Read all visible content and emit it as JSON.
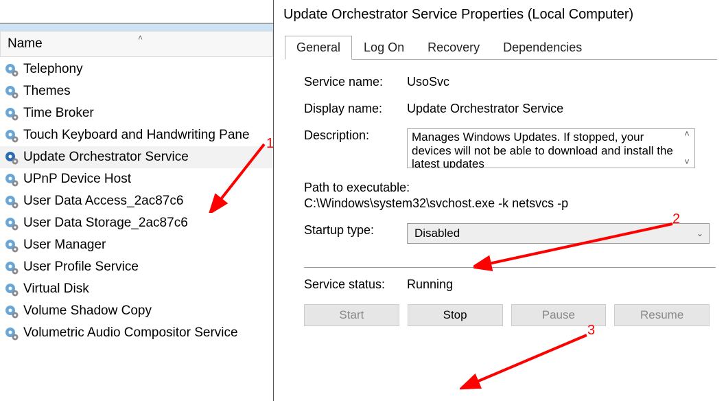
{
  "list": {
    "header": "Name",
    "items": [
      {
        "label": "Telephony",
        "selected": false
      },
      {
        "label": "Themes",
        "selected": false
      },
      {
        "label": "Time Broker",
        "selected": false
      },
      {
        "label": "Touch Keyboard and Handwriting Pane",
        "selected": false
      },
      {
        "label": "Update Orchestrator Service",
        "selected": true
      },
      {
        "label": "UPnP Device Host",
        "selected": false
      },
      {
        "label": "User Data Access_2ac87c6",
        "selected": false
      },
      {
        "label": "User Data Storage_2ac87c6",
        "selected": false
      },
      {
        "label": "User Manager",
        "selected": false
      },
      {
        "label": "User Profile Service",
        "selected": false
      },
      {
        "label": "Virtual Disk",
        "selected": false
      },
      {
        "label": "Volume Shadow Copy",
        "selected": false
      },
      {
        "label": "Volumetric Audio Compositor Service",
        "selected": false
      }
    ]
  },
  "dialog": {
    "title": "Update Orchestrator Service Properties (Local Computer)",
    "tabs": [
      "General",
      "Log On",
      "Recovery",
      "Dependencies"
    ],
    "active_tab": 0,
    "service_name_label": "Service name:",
    "service_name": "UsoSvc",
    "display_name_label": "Display name:",
    "display_name": "Update Orchestrator Service",
    "description_label": "Description:",
    "description": "Manages Windows Updates. If stopped, your devices will not be able to download and install the latest updates",
    "path_label": "Path to executable:",
    "path": "C:\\Windows\\system32\\svchost.exe -k netsvcs -p",
    "startup_label": "Startup type:",
    "startup_value": "Disabled",
    "status_label": "Service status:",
    "status_value": "Running",
    "buttons": {
      "start": "Start",
      "stop": "Stop",
      "pause": "Pause",
      "resume": "Resume"
    }
  },
  "annotations": {
    "a1": "1",
    "a2": "2",
    "a3": "3"
  },
  "colors": {
    "arrow": "#ff0000",
    "gear": "#3a86c8"
  }
}
